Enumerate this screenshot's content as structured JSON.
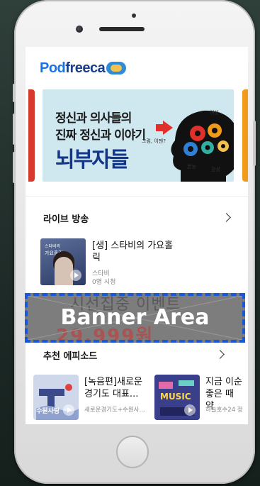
{
  "app": {
    "logo_text_pod": "Pod",
    "logo_text_rest": "freeca"
  },
  "hero": {
    "line1": "정신과 의사들의",
    "line2": "진짜 정신과 이야기",
    "line3": "뇌부자들",
    "scribble_a": "이성",
    "scribble_b": "그럼, 이젠?",
    "scribble_c": "감성",
    "scribble_d": "본능"
  },
  "live": {
    "section_title": "라이브 방송",
    "item": {
      "title": "[생] 스타비의 가요홀릭",
      "host": "스타비",
      "viewers": "0명 시청",
      "thumb_text_a": "스타비의",
      "thumb_text_b": "가요홀릭"
    }
  },
  "banner": {
    "label": "Banner Area",
    "bg_text_1": "시선집중 이벤트",
    "bg_text_2": "29,999원"
  },
  "episodes": {
    "section_title": "추천 에피소드",
    "items": [
      {
        "title": "[녹음편]새로운 경기도 대표...",
        "sub": "새로운경기도+수원사...",
        "thumb_text": "수원사랑"
      },
      {
        "title": "지금 이순 좋은 때 약",
        "sub": "하늘호수24 정",
        "thumb_text": "MUSIC"
      }
    ]
  },
  "colors": {
    "brand_blue": "#1a3e8c",
    "hero_bg": "#cfe7ef",
    "banner_border": "#1a59d6"
  }
}
